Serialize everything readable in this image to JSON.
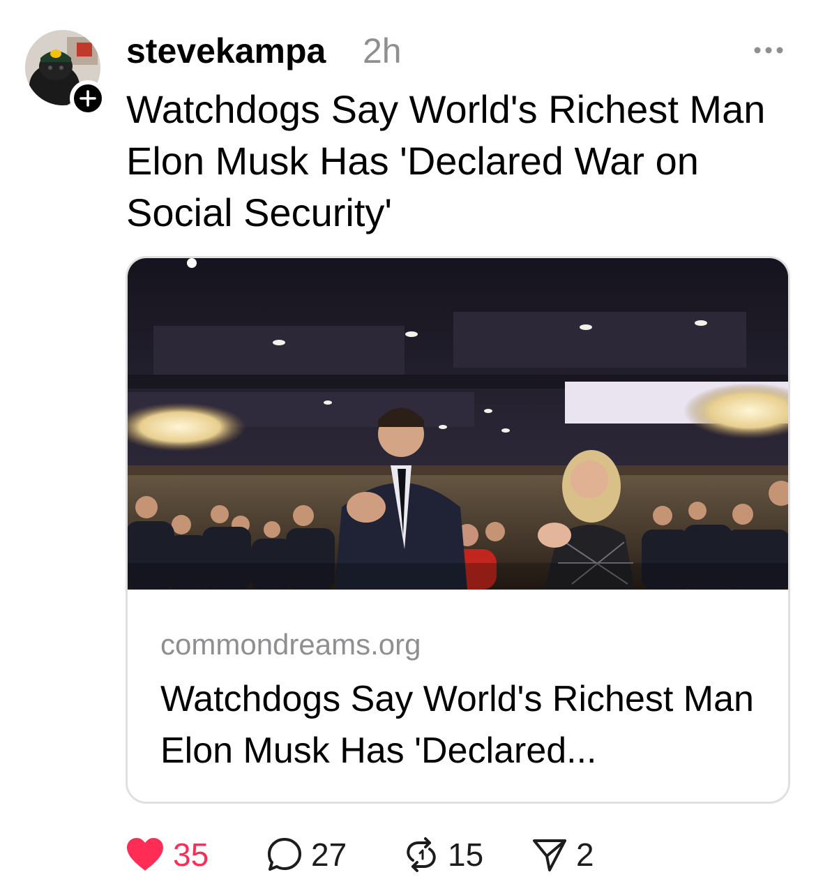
{
  "post": {
    "username": "stevekampa",
    "timestamp": "2h",
    "text": "Watchdogs Say World's Richest Man Elon Musk Has 'Declared War on Social Security'"
  },
  "link_card": {
    "domain": "commondreams.org",
    "title": "Watchdogs Say World's Richest Man Elon Musk Has 'Declared..."
  },
  "actions": {
    "likes": "35",
    "replies": "27",
    "reposts": "15",
    "shares": "2"
  },
  "colors": {
    "like_active": "#ff2d55",
    "secondary_text": "#8e8e93",
    "card_border": "#e0e0e0"
  },
  "icons": [
    "plus-icon",
    "more-icon",
    "heart-icon",
    "reply-icon",
    "repost-icon",
    "share-icon"
  ]
}
